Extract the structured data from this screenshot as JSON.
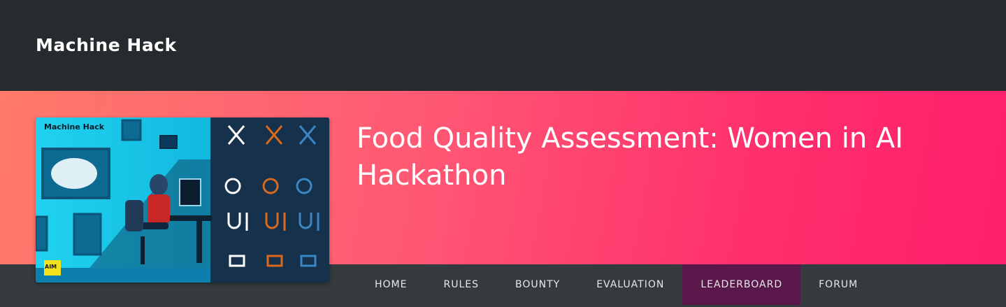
{
  "header": {
    "logo_text": "Machine Hack"
  },
  "hero": {
    "title": "Food Quality Assessment: Women in AI Hackathon",
    "thumbnail": {
      "logo_text": "Machine Hack",
      "badge_text": "AIM"
    }
  },
  "nav": {
    "items": [
      {
        "label": "HOME",
        "active": false
      },
      {
        "label": "RULES",
        "active": false
      },
      {
        "label": "BOUNTY",
        "active": false
      },
      {
        "label": "EVALUATION",
        "active": false
      },
      {
        "label": "LEADERBOARD",
        "active": true
      },
      {
        "label": "FORUM",
        "active": false
      }
    ]
  },
  "colors": {
    "header_bg": "#262b2e",
    "hero_gradient_start": "#ff7a6a",
    "hero_gradient_end": "#ff1f6b",
    "nav_bg": "#343a3d",
    "nav_active_bg": "#5a1749"
  }
}
